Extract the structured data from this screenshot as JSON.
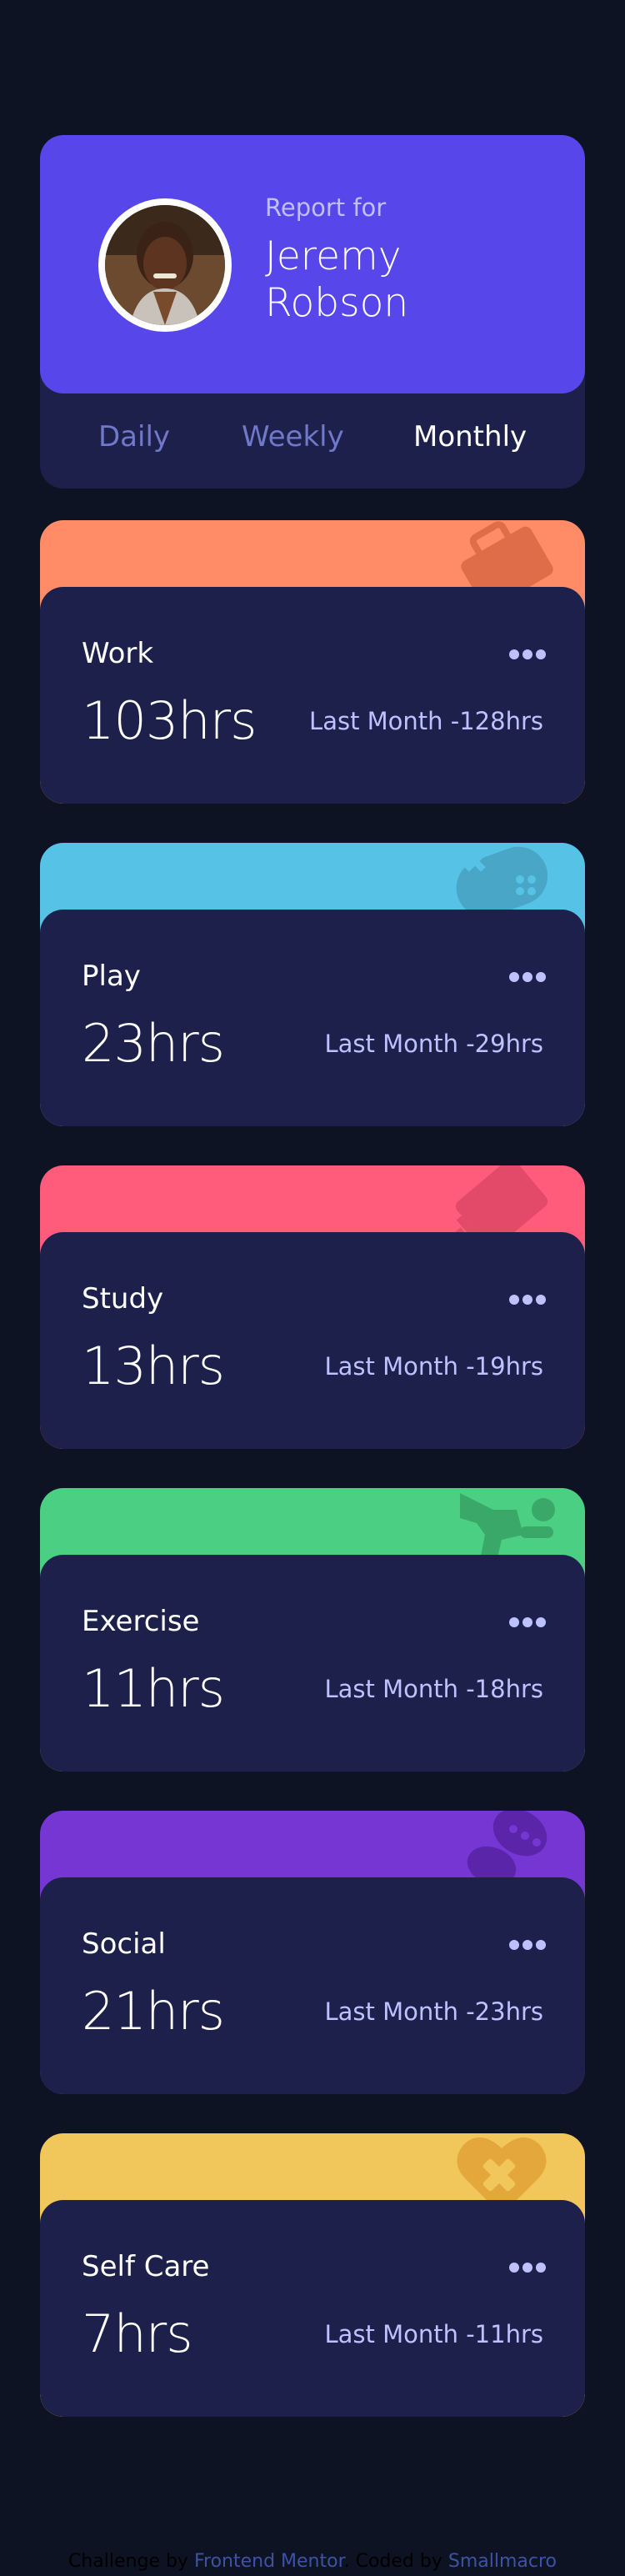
{
  "profile": {
    "report_for": "Report for",
    "name": "Jeremy Robson",
    "avatar_icon": "person-avatar-icon"
  },
  "periods": {
    "selected": "Monthly",
    "tabs": [
      {
        "label": "Daily"
      },
      {
        "label": "Weekly"
      },
      {
        "label": "Monthly"
      }
    ]
  },
  "activities": [
    {
      "title": "Work",
      "current": "103hrs",
      "previous": "Last Month -128hrs",
      "color": "#ff8c66",
      "icon": "briefcase-icon"
    },
    {
      "title": "Play",
      "current": "23hrs",
      "previous": "Last Month -29hrs",
      "color": "#56c2e6",
      "icon": "game-controller-icon"
    },
    {
      "title": "Study",
      "current": "13hrs",
      "previous": "Last Month -19hrs",
      "color": "#ff5c7c",
      "icon": "book-icon"
    },
    {
      "title": "Exercise",
      "current": "11hrs",
      "previous": "Last Month -18hrs",
      "color": "#4bcf83",
      "icon": "running-person-icon"
    },
    {
      "title": "Social",
      "current": "21hrs",
      "previous": "Last Month -23hrs",
      "color": "#7536d3",
      "icon": "chat-bubbles-icon"
    },
    {
      "title": "Self Care",
      "current": "7hrs",
      "previous": "Last Month -11hrs",
      "color": "#f1c65b",
      "icon": "heart-icon"
    }
  ],
  "footer": {
    "challenge_by": "Challenge by",
    "challenge_link": "Frontend Mentor",
    "coded_by": ". Coded by",
    "author_link": "Smallmacro"
  }
}
